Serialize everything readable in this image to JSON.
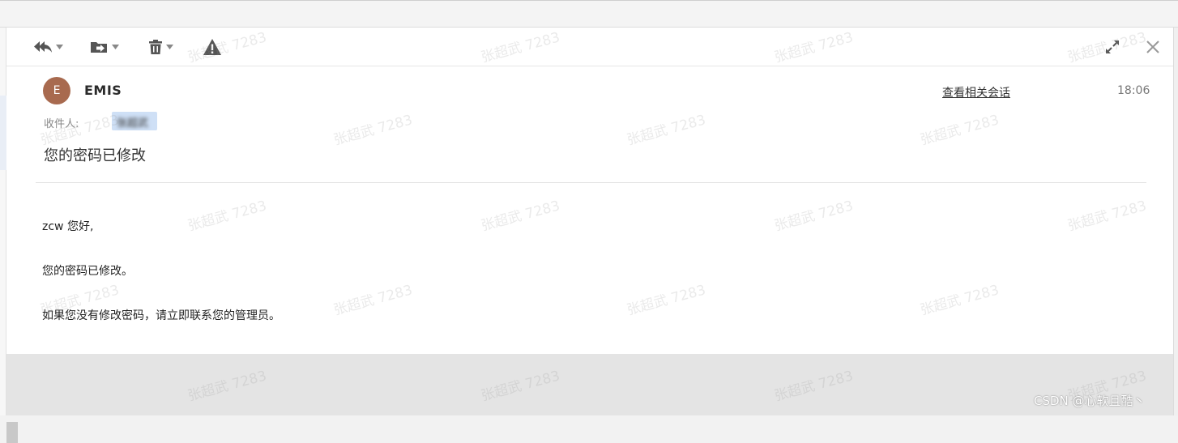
{
  "toolbar": {
    "icons": [
      "reply-all-icon",
      "move-to-folder-icon",
      "trash-icon",
      "warning-icon",
      "expand-icon",
      "close-icon"
    ]
  },
  "message": {
    "sender_initial": "E",
    "sender_name": "EMIS",
    "related_link": "查看相关会话",
    "time": "18:06",
    "recipient_label": "收件人:",
    "recipient_value": "张超武",
    "subject": "您的密码已修改"
  },
  "body": {
    "greeting": "zcw 您好,",
    "line1": "您的密码已修改。",
    "line2": "如果您没有修改密码，请立即联系您的管理员。"
  },
  "watermark": {
    "text": "张超武 7283"
  },
  "credit": {
    "text": "CSDN @心软且酷丶"
  },
  "colors": {
    "avatar": "#a86a4f",
    "icon": "#555555",
    "recipient_chip": "#cfe0f6"
  }
}
